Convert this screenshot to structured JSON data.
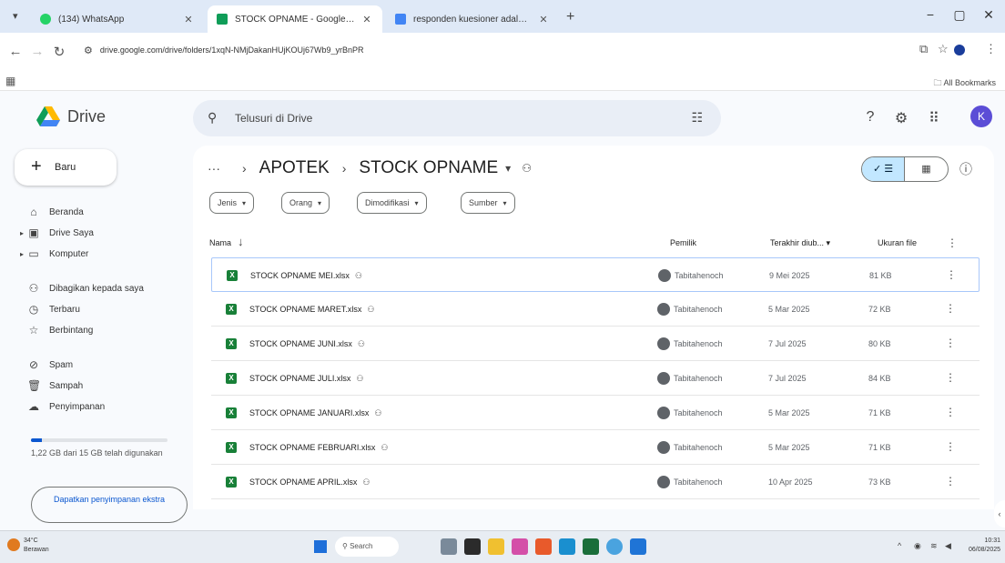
{
  "browser": {
    "tabs": [
      {
        "title": "(134) WhatsApp",
        "favicon_color": "#25d366",
        "active": false
      },
      {
        "title": "STOCK OPNAME - Google Dri...",
        "favicon_color": "#0f9d58",
        "active": true
      },
      {
        "title": "responden kuesioner adalah ...",
        "favicon_color": "#4285f4",
        "active": false
      }
    ],
    "url": "drive.google.com/drive/folders/1xqN-NMjDakanHUjKOUj67Wb9_yrBnPR",
    "all_bookmarks": "All Bookmarks"
  },
  "drive": {
    "app_name": "Drive",
    "search_placeholder": "Telusuri di Drive",
    "avatar_letter": "K"
  },
  "sidebar": {
    "new_label": "Baru",
    "items": [
      {
        "label": "Beranda",
        "icon": "home-icon"
      },
      {
        "label": "Drive Saya",
        "icon": "my-drive-icon"
      },
      {
        "label": "Komputer",
        "icon": "computer-icon"
      },
      {
        "label": "Dibagikan kepada saya",
        "icon": "shared-icon"
      },
      {
        "label": "Terbaru",
        "icon": "clock-icon"
      },
      {
        "label": "Berbintang",
        "icon": "star-icon"
      },
      {
        "label": "Spam",
        "icon": "spam-icon"
      },
      {
        "label": "Sampah",
        "icon": "trash-icon"
      },
      {
        "label": "Penyimpanan",
        "icon": "cloud-icon"
      }
    ],
    "storage_text": "1,22 GB dari 15 GB telah digunakan",
    "storage_used_fraction": 0.081,
    "get_storage_label": "Dapatkan penyimpanan ekstra"
  },
  "breadcrumb": {
    "parent": "APOTEK",
    "current": "STOCK OPNAME"
  },
  "filters": [
    "Jenis",
    "Orang",
    "Dimodifikasi",
    "Sumber"
  ],
  "columns": {
    "name": "Nama",
    "owner": "Pemilik",
    "modified": "Terakhir diub...",
    "size": "Ukuran file"
  },
  "files": [
    {
      "name": "STOCK OPNAME MEI.xlsx",
      "owner": "Tabitahenoch",
      "modified": "9 Mei 2025",
      "size": "81 KB"
    },
    {
      "name": "STOCK OPNAME MARET.xlsx",
      "owner": "Tabitahenoch",
      "modified": "5 Mar 2025",
      "size": "72 KB"
    },
    {
      "name": "STOCK OPNAME JUNI.xlsx",
      "owner": "Tabitahenoch",
      "modified": "7 Jul 2025",
      "size": "80 KB"
    },
    {
      "name": "STOCK OPNAME JULI.xlsx",
      "owner": "Tabitahenoch",
      "modified": "7 Jul 2025",
      "size": "84 KB"
    },
    {
      "name": "STOCK OPNAME JANUARI.xlsx",
      "owner": "Tabitahenoch",
      "modified": "5 Mar 2025",
      "size": "71 KB"
    },
    {
      "name": "STOCK OPNAME FEBRUARI.xlsx",
      "owner": "Tabitahenoch",
      "modified": "5 Mar 2025",
      "size": "71 KB"
    },
    {
      "name": "STOCK OPNAME APRIL.xlsx",
      "owner": "Tabitahenoch",
      "modified": "10 Apr 2025",
      "size": "73 KB"
    }
  ],
  "taskbar": {
    "weather_temp": "34°C",
    "weather_desc": "Berawan",
    "search": "Search",
    "time": "10:31",
    "date": "06/08/2025"
  },
  "colors": {
    "accent": "#0b57d0",
    "sheets_green": "#188038",
    "selected_toggle": "#c2e7ff"
  }
}
